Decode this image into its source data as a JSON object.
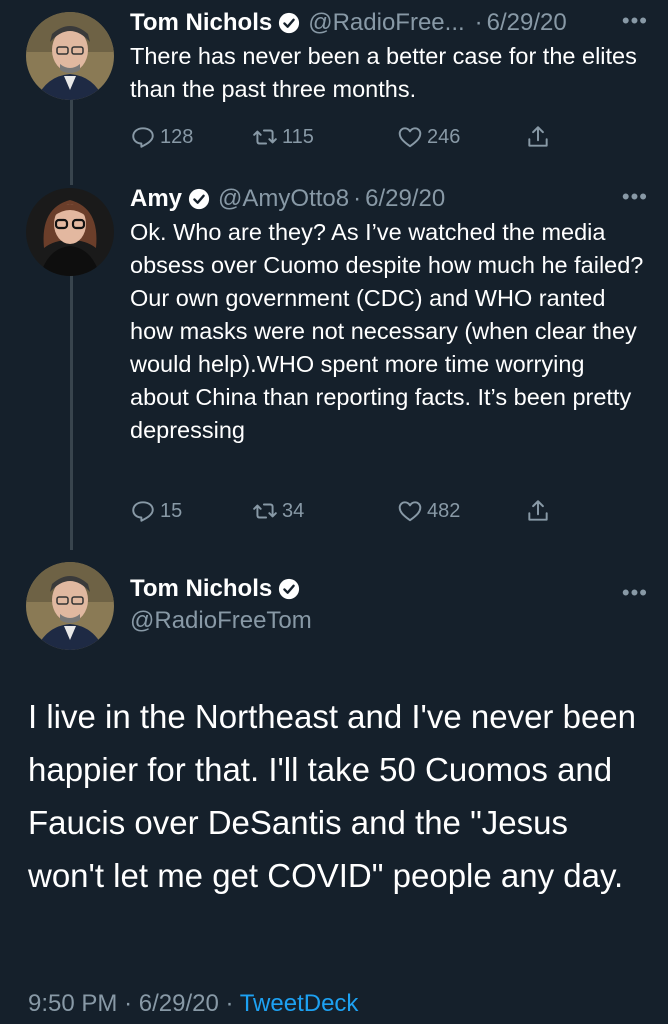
{
  "tweets": [
    {
      "name": "Tom Nichols",
      "handle": "@RadioFree...",
      "sep": "·",
      "date": "6/29/20",
      "text": "There has never been a better case for the elites than the past three months.",
      "replies": "128",
      "retweets": "115",
      "likes": "246"
    },
    {
      "name": "Amy",
      "handle": "@AmyOtto8",
      "sep": "·",
      "date": "6/29/20",
      "text": "Ok. Who are they? As I’ve watched the media obsess over Cuomo despite how much he failed?  Our own government (CDC) and WHO ranted how masks were not necessary (when clear they would help).WHO spent more time worrying about China than reporting facts.  It’s been pretty depressing",
      "replies": "15",
      "retweets": "34",
      "likes": "482"
    }
  ],
  "main_tweet": {
    "name": "Tom Nichols",
    "handle": "@RadioFreeTom",
    "text": "I live in the Northeast and I've never been happier for that. I'll take 50 Cuomos and Faucis over DeSantis and the \"Jesus won't let me get COVID\" people any day.",
    "time": "9:50 PM",
    "sep": "·",
    "date": "6/29/20",
    "source": "TweetDeck"
  },
  "icons": {
    "more": "more-icon",
    "reply": "reply-icon",
    "retweet": "retweet-icon",
    "like": "like-icon",
    "share": "share-icon",
    "verified": "verified-icon"
  },
  "colors": {
    "background": "#15202b",
    "secondary_text": "#8899a6",
    "link": "#1da1f2",
    "thread_line": "#38444d"
  }
}
